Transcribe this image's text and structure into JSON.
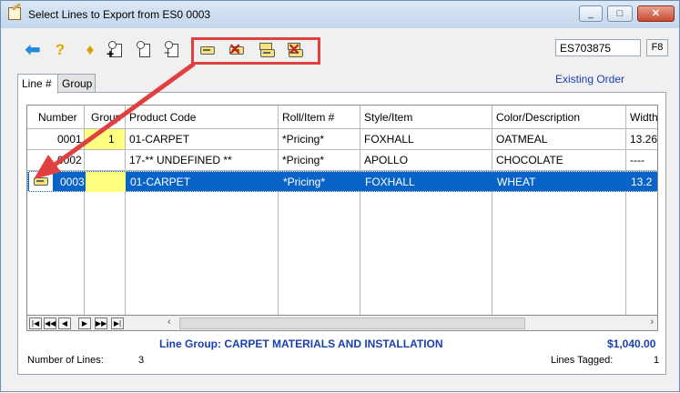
{
  "window": {
    "title": "Select Lines to Export from ES0 0003",
    "minimize": "_",
    "maximize": "□",
    "close": "✕"
  },
  "toolbar": {
    "back_icon": "back-arrow-icon",
    "help_icon": "help-icon",
    "order_number": "ES703875",
    "f8_label": "F8"
  },
  "tabs": [
    {
      "label": "Line #"
    },
    {
      "label": "Group"
    }
  ],
  "existing_order": "Existing Order",
  "columns": [
    "Number",
    "Group",
    "Product Code",
    "Roll/Item #",
    "Style/Item",
    "Color/Description",
    "Width"
  ],
  "rows": [
    {
      "number": "0001",
      "group": "1",
      "product": "01-CARPET",
      "roll": "*Pricing*",
      "style": "FOXHALL",
      "color": "OATMEAL",
      "width": "13.26"
    },
    {
      "number": "0002",
      "group": "",
      "product": "17-** UNDEFINED **",
      "roll": "*Pricing*",
      "style": "APOLLO",
      "color": "CHOCOLATE",
      "width": "----"
    },
    {
      "number": "0003",
      "group": "",
      "product": "01-CARPET",
      "roll": "*Pricing*",
      "style": "FOXHALL",
      "color": "WHEAT",
      "width": "13.2"
    }
  ],
  "nav_buttons": [
    "|◀",
    "◀◀",
    "◀",
    "▶",
    "▶▶",
    "▶|"
  ],
  "footer": {
    "line_group": "Line Group: CARPET MATERIALS AND INSTALLATION",
    "total": "$1,040.00",
    "num_lines_label": "Number of Lines:",
    "num_lines_value": "3",
    "lines_tagged_label": "Lines Tagged:",
    "lines_tagged_value": "1"
  },
  "colors": {
    "selection": "#0a64c8",
    "group_highlight": "#ffff80",
    "annotation": "#e04040",
    "link_blue": "#1a3fb0"
  }
}
